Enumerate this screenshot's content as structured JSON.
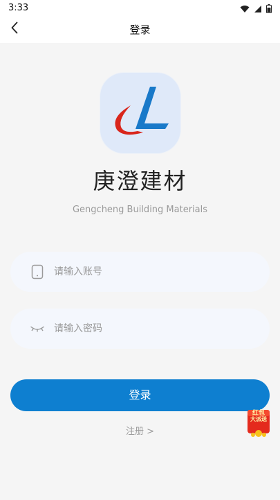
{
  "status_bar": {
    "time": "3:33",
    "icons": [
      "wifi-icon",
      "signal-icon",
      "battery-icon"
    ]
  },
  "header": {
    "back_icon": "chevron-left-icon",
    "title": "登录"
  },
  "brand": {
    "logo_icon": "gengcheng-logo-icon",
    "name": "庚澄建材",
    "subtitle": "Gengcheng Building Materials"
  },
  "form": {
    "account": {
      "icon": "phone-icon",
      "placeholder": "请输入账号",
      "value": ""
    },
    "password": {
      "icon": "eye-closed-icon",
      "placeholder": "请输入密码",
      "value": ""
    },
    "login_label": "登录",
    "register_label": "注册 >"
  },
  "promo": {
    "icon": "red-packet-icon",
    "text_line1": "红包",
    "text_line2": "大派送"
  },
  "colors": {
    "primary": "#0e7fd0",
    "background": "#f5f5f5",
    "field_bg": "#f4f7fd",
    "logo_bg": "#dfe9f9",
    "logo_red": "#d9261c"
  }
}
